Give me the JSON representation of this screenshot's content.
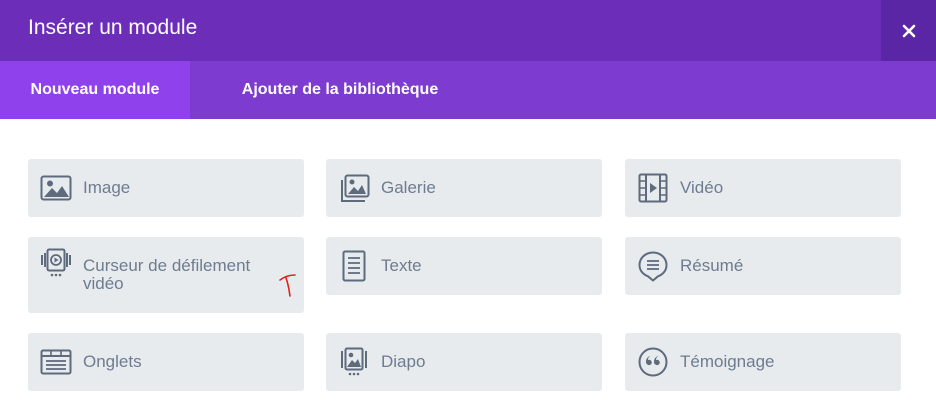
{
  "header": {
    "title": "Insérer un module",
    "close_icon": "close-icon"
  },
  "tabs": [
    {
      "label": "Nouveau module",
      "active": true
    },
    {
      "label": "Ajouter de la bibliothèque",
      "active": false
    }
  ],
  "modules": [
    {
      "label": "Image",
      "icon": "image-icon"
    },
    {
      "label": "Galerie",
      "icon": "gallery-icon"
    },
    {
      "label": "Vidéo",
      "icon": "video-icon"
    },
    {
      "label": "Curseur de défilement vidéo",
      "icon": "video-slider-icon"
    },
    {
      "label": "Texte",
      "icon": "text-icon"
    },
    {
      "label": "Résumé",
      "icon": "blurb-icon"
    },
    {
      "label": "Onglets",
      "icon": "tabs-icon"
    },
    {
      "label": "Diapo",
      "icon": "slider-icon"
    },
    {
      "label": "Témoignage",
      "icon": "testimonial-icon"
    }
  ],
  "colors": {
    "header_bg": "#6c2eb9",
    "tabs_bg": "#7e3bd0",
    "active_tab_bg": "#8f42ec",
    "module_bg": "#e8ebee",
    "module_text": "#6d7c90"
  }
}
